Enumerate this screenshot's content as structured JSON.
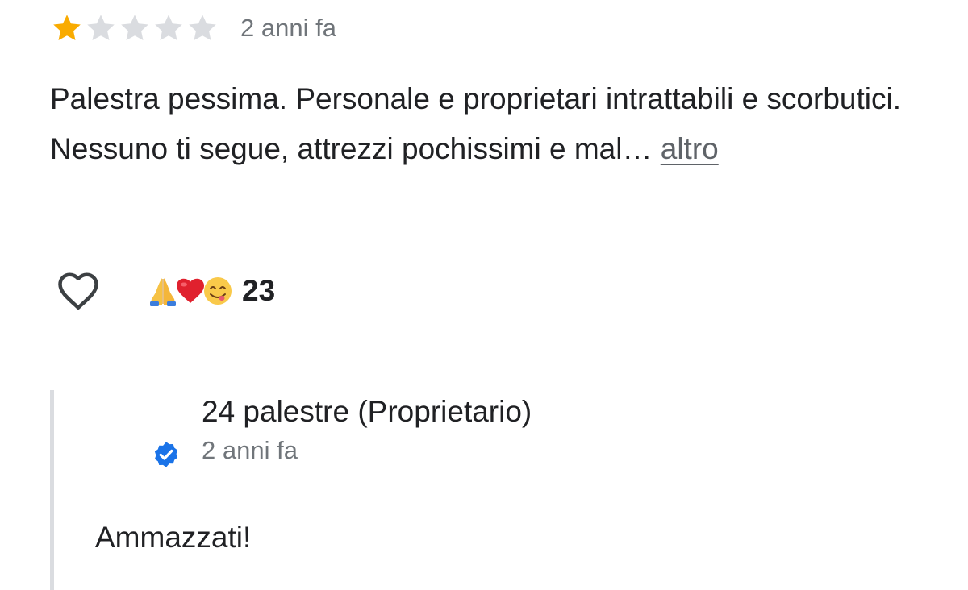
{
  "review": {
    "rating": 1,
    "max_rating": 5,
    "date": "2 anni fa",
    "text_line_1": "Palestra pessima. Personale e proprietari intrattabili e scorbutici.",
    "text_line_2": "Nessuno ti segue, attrezzi pochissimi e mal…",
    "more_label": "altro",
    "colors": {
      "star_filled": "#f9ab00",
      "star_empty": "#dadce0",
      "link": "#5f6368",
      "secondary_text": "#70757a"
    }
  },
  "reactions": {
    "like_icon": "heart-outline-icon",
    "emojis": [
      "folded-hands-emoji",
      "red-heart-emoji",
      "savoring-face-emoji"
    ],
    "count": "23"
  },
  "owner_reply": {
    "name": "24 palestre (Proprietario)",
    "verified_icon": "verified-check-icon",
    "verified_color": "#1a73e8",
    "date": "2 anni fa",
    "text": "Ammazzati!"
  }
}
